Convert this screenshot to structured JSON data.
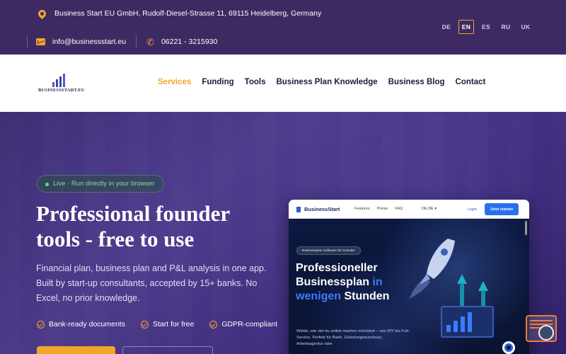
{
  "topbar": {
    "address": "Business Start EU GmbH, Rudolf-Diesel-Strasse 11, 69115 Heidelberg, Germany",
    "email": "info@businessstart.eu",
    "phone": "06221 - 3215930",
    "languages": [
      "DE",
      "EN",
      "ES",
      "RU",
      "UK"
    ],
    "active_language": "EN"
  },
  "header": {
    "brand": "BUSINESSSTART.EU",
    "nav": [
      "Services",
      "Funding",
      "Tools",
      "Business Plan Knowledge",
      "Business Blog",
      "Contact"
    ],
    "active_nav": "Services"
  },
  "hero": {
    "badge": "Live · Run directly in your browser",
    "title": "Professional founder tools - free to use",
    "lead": "Financial plan, business plan and P&L analysis in one app. Built by start-up consultants, accepted by 15+ banks. No Excel, no prior knowledge.",
    "checks": [
      "Bank-ready documents",
      "Start for free",
      "GDPR-compliant"
    ]
  },
  "mockup": {
    "brand": "BusinessStart",
    "links": [
      "Features",
      "Preise",
      "FAQ"
    ],
    "lang": "DE DE ▾",
    "login": "Login",
    "start": "Jetzt starten",
    "pill": "Businessplan Software für Gründer",
    "headline_a": "Professioneller Businessplan ",
    "headline_b": "in wenigen",
    "headline_c": " Stunden",
    "sub": "Wähle, wie viel du selbst machen möchtest – von DIY bis Full-Service. Perfekt für Bank, Gründungszuschuss, Arbeitsagentur oder"
  },
  "colors": {
    "accent": "#f3a52a",
    "topbar": "#3d2a63",
    "hero": "#3a2b6e"
  }
}
